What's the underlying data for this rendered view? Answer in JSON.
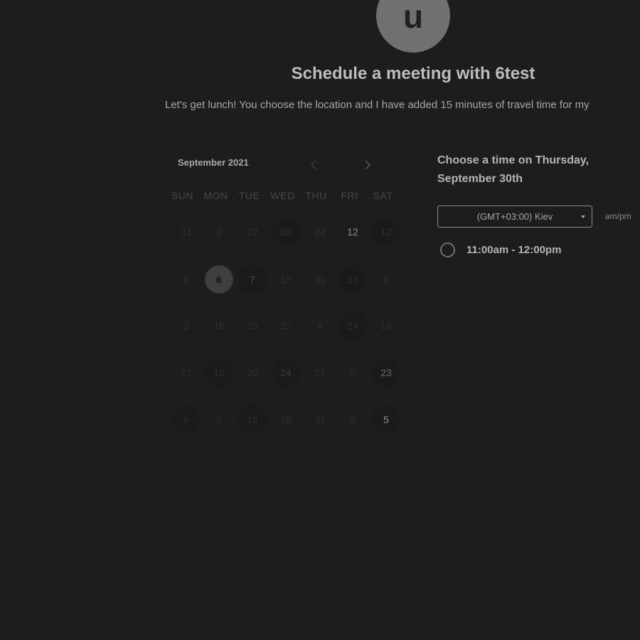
{
  "header": {
    "avatar_initial": "u",
    "title": "Schedule a meeting with 6test",
    "description": "Let's get lunch! You choose the location and I have added 15 minutes of travel time for my"
  },
  "calendar": {
    "month_label": "September 2021",
    "prev_icon": "chevron-left-icon",
    "next_icon": "chevron-right-icon",
    "weekdays": [
      "SUN",
      "MON",
      "TUE",
      "WED",
      "THU",
      "FRI",
      "SAT"
    ],
    "weeks": [
      [
        "31",
        "2",
        "22",
        "30",
        "24",
        "12",
        "12"
      ],
      [
        "9",
        "6",
        "7",
        "17",
        "31",
        "27",
        "8"
      ],
      [
        "2",
        "16",
        "25",
        "22",
        "8",
        "24",
        "16"
      ],
      [
        "27",
        "10",
        "30",
        "24",
        "27",
        "8",
        "23"
      ],
      [
        "6",
        "2",
        "13",
        "18",
        "31",
        "8",
        "5"
      ]
    ],
    "selected_day": "6",
    "colors": {
      "selected_bg": "#3f3f3f",
      "text_dim": "#2e2e2e",
      "text_bright": "#909090"
    }
  },
  "time_panel": {
    "title": "Choose a time on Thursday, September 30th",
    "timezone": "(GMT+03:00) Kiev",
    "ampm_label": "am/pm",
    "slots": [
      {
        "label": "11:00am - 12:00pm"
      }
    ]
  },
  "theme": {
    "background": "#1d1d1d",
    "avatar_bg": "#707070"
  }
}
